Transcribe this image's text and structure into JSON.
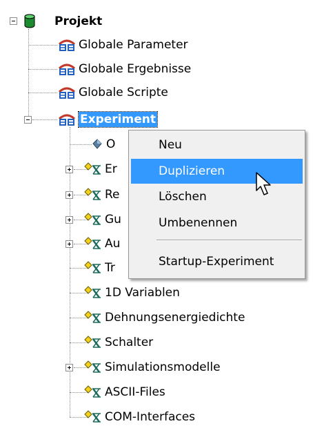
{
  "tree": {
    "root": {
      "label": "Projekt",
      "icon": "database-icon",
      "expanded": true
    },
    "items": [
      {
        "label": "Globale Parameter",
        "icon": "parameter-group-icon"
      },
      {
        "label": "Globale Ergebnisse",
        "icon": "parameter-group-icon"
      },
      {
        "label": "Globale Scripte",
        "icon": "parameter-group-icon"
      },
      {
        "label": "Experiment",
        "icon": "parameter-group-icon",
        "selected": true,
        "expanded": true
      }
    ],
    "experiment_children": [
      {
        "label": "O",
        "icon": "diamond-icon"
      },
      {
        "label": "Er",
        "icon": "variable-folder-icon",
        "expandable": true
      },
      {
        "label": "Re",
        "icon": "variable-folder-icon",
        "expandable": true
      },
      {
        "label": "Gu",
        "icon": "variable-folder-icon",
        "expandable": true
      },
      {
        "label": "Au",
        "icon": "variable-folder-icon",
        "expandable": true
      },
      {
        "label": "Tr",
        "icon": "variable-folder-icon",
        "expandable": false
      },
      {
        "label": "1D Variablen",
        "icon": "variable-folder-icon",
        "expandable": false
      },
      {
        "label": "Dehnungsenergiedichte",
        "icon": "variable-folder-icon",
        "expandable": false
      },
      {
        "label": "Schalter",
        "icon": "variable-folder-icon",
        "expandable": false
      },
      {
        "label": "Simulationsmodelle",
        "icon": "variable-folder-icon",
        "expandable": true
      },
      {
        "label": "ASCII-Files",
        "icon": "variable-folder-icon",
        "expandable": false
      },
      {
        "label": "COM-Interfaces",
        "icon": "variable-folder-icon",
        "expandable": false
      }
    ]
  },
  "context_menu": {
    "items": [
      {
        "label": "Neu"
      },
      {
        "label": "Duplizieren",
        "highlighted": true
      },
      {
        "label": "Löschen"
      },
      {
        "label": "Umbenennen"
      },
      {
        "label": "Startup-Experiment"
      }
    ]
  },
  "colors": {
    "selection": "#3399ff",
    "menu_background": "#f0f0f0",
    "root_icon": "#1c8a2e",
    "group_icon_roof": "#c0392b",
    "group_icon_body": "#1f5fbf"
  },
  "cursor": {
    "icon": "arrow-pointer-icon"
  }
}
